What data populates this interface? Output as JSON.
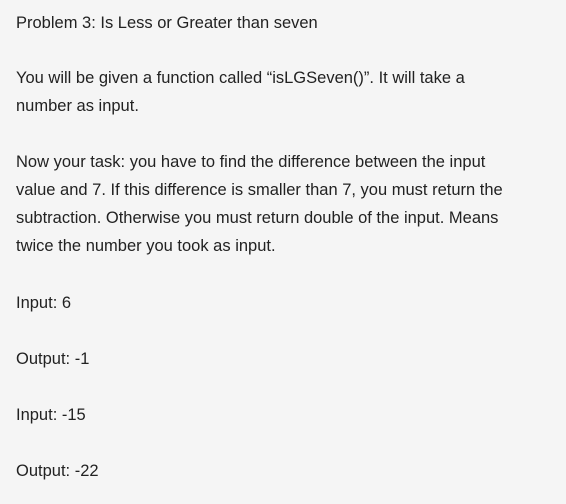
{
  "problem": {
    "title": "Problem 3: Is Less or Greater than seven",
    "intro_lines": [
      "You will be given a function called “isLGSeven()”. It will take a",
      "number as input."
    ],
    "task_lines": [
      "Now your task: you have to find the difference between the input",
      "value and 7. If this difference is smaller than 7, you must return the",
      "subtraction. Otherwise you must return double of the input. Means",
      "twice the number you took as input."
    ],
    "examples": [
      {
        "input": "Input: 6",
        "output": "Output: -1"
      },
      {
        "input": "Input: -15",
        "output": "Output: -22"
      }
    ]
  }
}
